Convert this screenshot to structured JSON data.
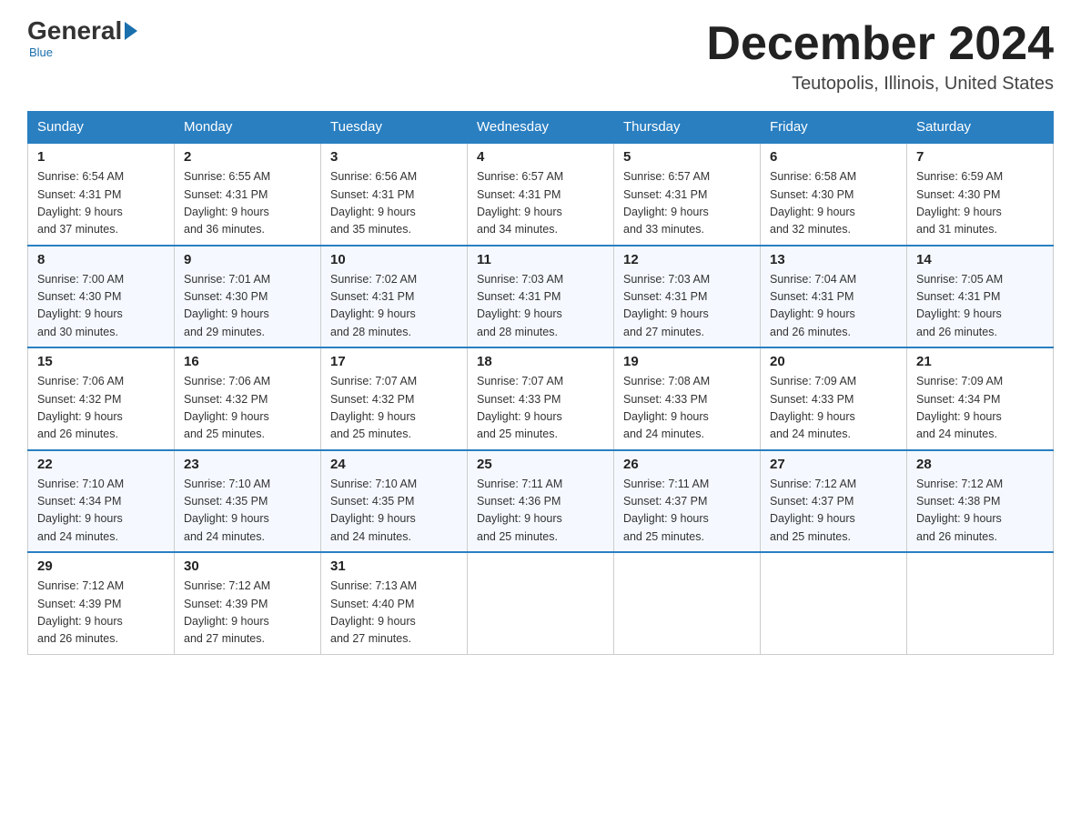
{
  "header": {
    "logo": {
      "general": "General",
      "blue": "Blue",
      "subtitle": "Blue"
    },
    "title": "December 2024",
    "location": "Teutopolis, Illinois, United States"
  },
  "days_of_week": [
    "Sunday",
    "Monday",
    "Tuesday",
    "Wednesday",
    "Thursday",
    "Friday",
    "Saturday"
  ],
  "weeks": [
    [
      {
        "day": "1",
        "sunrise": "6:54 AM",
        "sunset": "4:31 PM",
        "daylight": "9 hours and 37 minutes."
      },
      {
        "day": "2",
        "sunrise": "6:55 AM",
        "sunset": "4:31 PM",
        "daylight": "9 hours and 36 minutes."
      },
      {
        "day": "3",
        "sunrise": "6:56 AM",
        "sunset": "4:31 PM",
        "daylight": "9 hours and 35 minutes."
      },
      {
        "day": "4",
        "sunrise": "6:57 AM",
        "sunset": "4:31 PM",
        "daylight": "9 hours and 34 minutes."
      },
      {
        "day": "5",
        "sunrise": "6:57 AM",
        "sunset": "4:31 PM",
        "daylight": "9 hours and 33 minutes."
      },
      {
        "day": "6",
        "sunrise": "6:58 AM",
        "sunset": "4:30 PM",
        "daylight": "9 hours and 32 minutes."
      },
      {
        "day": "7",
        "sunrise": "6:59 AM",
        "sunset": "4:30 PM",
        "daylight": "9 hours and 31 minutes."
      }
    ],
    [
      {
        "day": "8",
        "sunrise": "7:00 AM",
        "sunset": "4:30 PM",
        "daylight": "9 hours and 30 minutes."
      },
      {
        "day": "9",
        "sunrise": "7:01 AM",
        "sunset": "4:30 PM",
        "daylight": "9 hours and 29 minutes."
      },
      {
        "day": "10",
        "sunrise": "7:02 AM",
        "sunset": "4:31 PM",
        "daylight": "9 hours and 28 minutes."
      },
      {
        "day": "11",
        "sunrise": "7:03 AM",
        "sunset": "4:31 PM",
        "daylight": "9 hours and 28 minutes."
      },
      {
        "day": "12",
        "sunrise": "7:03 AM",
        "sunset": "4:31 PM",
        "daylight": "9 hours and 27 minutes."
      },
      {
        "day": "13",
        "sunrise": "7:04 AM",
        "sunset": "4:31 PM",
        "daylight": "9 hours and 26 minutes."
      },
      {
        "day": "14",
        "sunrise": "7:05 AM",
        "sunset": "4:31 PM",
        "daylight": "9 hours and 26 minutes."
      }
    ],
    [
      {
        "day": "15",
        "sunrise": "7:06 AM",
        "sunset": "4:32 PM",
        "daylight": "9 hours and 26 minutes."
      },
      {
        "day": "16",
        "sunrise": "7:06 AM",
        "sunset": "4:32 PM",
        "daylight": "9 hours and 25 minutes."
      },
      {
        "day": "17",
        "sunrise": "7:07 AM",
        "sunset": "4:32 PM",
        "daylight": "9 hours and 25 minutes."
      },
      {
        "day": "18",
        "sunrise": "7:07 AM",
        "sunset": "4:33 PM",
        "daylight": "9 hours and 25 minutes."
      },
      {
        "day": "19",
        "sunrise": "7:08 AM",
        "sunset": "4:33 PM",
        "daylight": "9 hours and 24 minutes."
      },
      {
        "day": "20",
        "sunrise": "7:09 AM",
        "sunset": "4:33 PM",
        "daylight": "9 hours and 24 minutes."
      },
      {
        "day": "21",
        "sunrise": "7:09 AM",
        "sunset": "4:34 PM",
        "daylight": "9 hours and 24 minutes."
      }
    ],
    [
      {
        "day": "22",
        "sunrise": "7:10 AM",
        "sunset": "4:34 PM",
        "daylight": "9 hours and 24 minutes."
      },
      {
        "day": "23",
        "sunrise": "7:10 AM",
        "sunset": "4:35 PM",
        "daylight": "9 hours and 24 minutes."
      },
      {
        "day": "24",
        "sunrise": "7:10 AM",
        "sunset": "4:35 PM",
        "daylight": "9 hours and 24 minutes."
      },
      {
        "day": "25",
        "sunrise": "7:11 AM",
        "sunset": "4:36 PM",
        "daylight": "9 hours and 25 minutes."
      },
      {
        "day": "26",
        "sunrise": "7:11 AM",
        "sunset": "4:37 PM",
        "daylight": "9 hours and 25 minutes."
      },
      {
        "day": "27",
        "sunrise": "7:12 AM",
        "sunset": "4:37 PM",
        "daylight": "9 hours and 25 minutes."
      },
      {
        "day": "28",
        "sunrise": "7:12 AM",
        "sunset": "4:38 PM",
        "daylight": "9 hours and 26 minutes."
      }
    ],
    [
      {
        "day": "29",
        "sunrise": "7:12 AM",
        "sunset": "4:39 PM",
        "daylight": "9 hours and 26 minutes."
      },
      {
        "day": "30",
        "sunrise": "7:12 AM",
        "sunset": "4:39 PM",
        "daylight": "9 hours and 27 minutes."
      },
      {
        "day": "31",
        "sunrise": "7:13 AM",
        "sunset": "4:40 PM",
        "daylight": "9 hours and 27 minutes."
      },
      null,
      null,
      null,
      null
    ]
  ],
  "labels": {
    "sunrise": "Sunrise: ",
    "sunset": "Sunset: ",
    "daylight": "Daylight: "
  }
}
